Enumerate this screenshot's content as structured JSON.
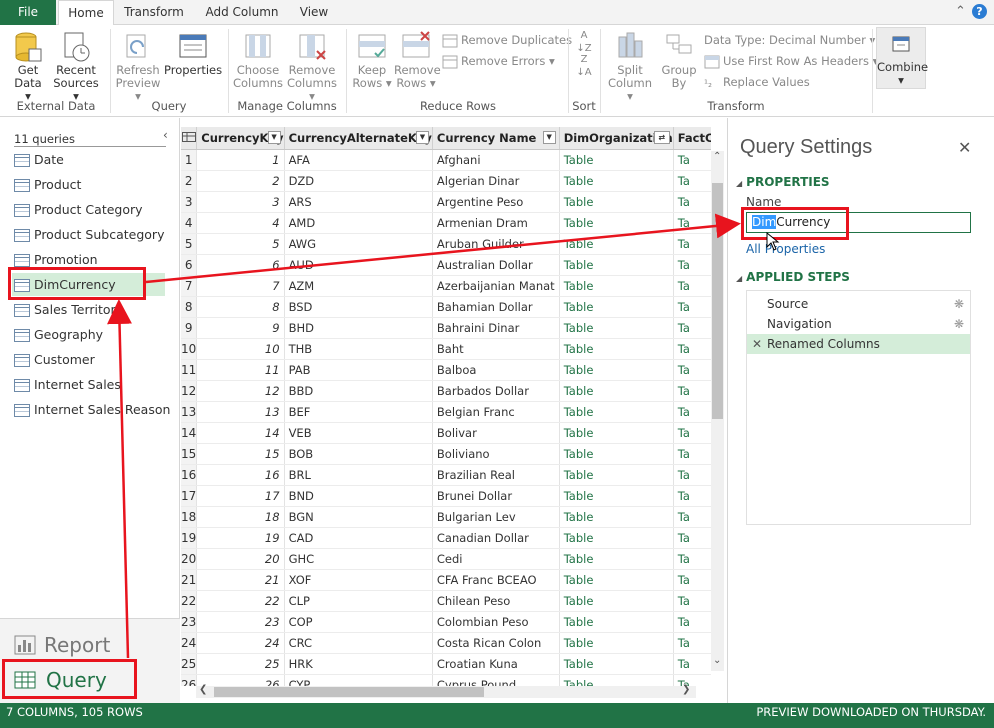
{
  "tabs": {
    "file": "File",
    "home": "Home",
    "transform": "Transform",
    "add_column": "Add Column",
    "view": "View"
  },
  "ribbon": {
    "get_data": "Get Data",
    "recent_sources": "Recent Sources",
    "refresh_preview": "Refresh Preview",
    "properties": "Properties",
    "choose_columns": "Choose Columns",
    "remove_columns": "Remove Columns",
    "keep_rows": "Keep Rows",
    "remove_rows": "Remove Rows",
    "remove_duplicates": "Remove Duplicates",
    "remove_errors": "Remove Errors",
    "data_type": "Data Type: Decimal Number",
    "first_row_headers": "Use First Row As Headers",
    "replace_values": "Replace Values",
    "split_column": "Split Column",
    "group_by": "Group By",
    "combine": "Combine",
    "groups": {
      "external_data": "External Data",
      "query": "Query",
      "manage_columns": "Manage Columns",
      "reduce_rows": "Reduce Rows",
      "sort": "Sort",
      "transform": "Transform"
    }
  },
  "left_pane": {
    "count": "11 queries",
    "queries": [
      "Date",
      "Product",
      "Product Category",
      "Product Subcategory",
      "Promotion",
      "DimCurrency",
      "Sales Territory",
      "Geography",
      "Customer",
      "Internet Sales",
      "Internet Sales Reason"
    ],
    "selected_index": 5,
    "report_label": "Report",
    "query_label": "Query"
  },
  "grid": {
    "columns": [
      "CurrencyKey",
      "CurrencyAlternateKey",
      "Currency Name",
      "DimOrganization",
      "FactC"
    ],
    "rows": [
      [
        1,
        "AFA",
        "Afghani",
        "Table",
        "Ta"
      ],
      [
        2,
        "DZD",
        "Algerian Dinar",
        "Table",
        "Ta"
      ],
      [
        3,
        "ARS",
        "Argentine Peso",
        "Table",
        "Ta"
      ],
      [
        4,
        "AMD",
        "Armenian Dram",
        "Table",
        "Ta"
      ],
      [
        5,
        "AWG",
        "Aruban Guilder",
        "Table",
        "Ta"
      ],
      [
        6,
        "AUD",
        "Australian Dollar",
        "Table",
        "Ta"
      ],
      [
        7,
        "AZM",
        "Azerbaijanian Manat",
        "Table",
        "Ta"
      ],
      [
        8,
        "BSD",
        "Bahamian Dollar",
        "Table",
        "Ta"
      ],
      [
        9,
        "BHD",
        "Bahraini Dinar",
        "Table",
        "Ta"
      ],
      [
        10,
        "THB",
        "Baht",
        "Table",
        "Ta"
      ],
      [
        11,
        "PAB",
        "Balboa",
        "Table",
        "Ta"
      ],
      [
        12,
        "BBD",
        "Barbados Dollar",
        "Table",
        "Ta"
      ],
      [
        13,
        "BEF",
        "Belgian Franc",
        "Table",
        "Ta"
      ],
      [
        14,
        "VEB",
        "Bolivar",
        "Table",
        "Ta"
      ],
      [
        15,
        "BOB",
        "Boliviano",
        "Table",
        "Ta"
      ],
      [
        16,
        "BRL",
        "Brazilian Real",
        "Table",
        "Ta"
      ],
      [
        17,
        "BND",
        "Brunei Dollar",
        "Table",
        "Ta"
      ],
      [
        18,
        "BGN",
        "Bulgarian Lev",
        "Table",
        "Ta"
      ],
      [
        19,
        "CAD",
        "Canadian Dollar",
        "Table",
        "Ta"
      ],
      [
        20,
        "GHC",
        "Cedi",
        "Table",
        "Ta"
      ],
      [
        21,
        "XOF",
        "CFA Franc BCEAO",
        "Table",
        "Ta"
      ],
      [
        22,
        "CLP",
        "Chilean Peso",
        "Table",
        "Ta"
      ],
      [
        23,
        "COP",
        "Colombian Peso",
        "Table",
        "Ta"
      ],
      [
        24,
        "CRC",
        "Costa Rican Colon",
        "Table",
        "Ta"
      ],
      [
        25,
        "HRK",
        "Croatian Kuna",
        "Table",
        "Ta"
      ],
      [
        26,
        "CYP",
        "Cyprus Pound",
        "Table",
        "Ta"
      ]
    ]
  },
  "query_settings": {
    "title": "Query Settings",
    "properties_header": "PROPERTIES",
    "name_label": "Name",
    "name_highlight": "Dim",
    "name_rest": "Currency",
    "all_properties": "All Properties",
    "applied_steps_header": "APPLIED STEPS",
    "steps": [
      "Source",
      "Navigation",
      "Renamed Columns"
    ]
  },
  "status": {
    "left": "7 COLUMNS, 105 ROWS",
    "right": "PREVIEW DOWNLOADED ON THURSDAY."
  },
  "colors": {
    "accent": "#217346",
    "annotation": "#e8141e",
    "selection": "#d4edd9"
  }
}
